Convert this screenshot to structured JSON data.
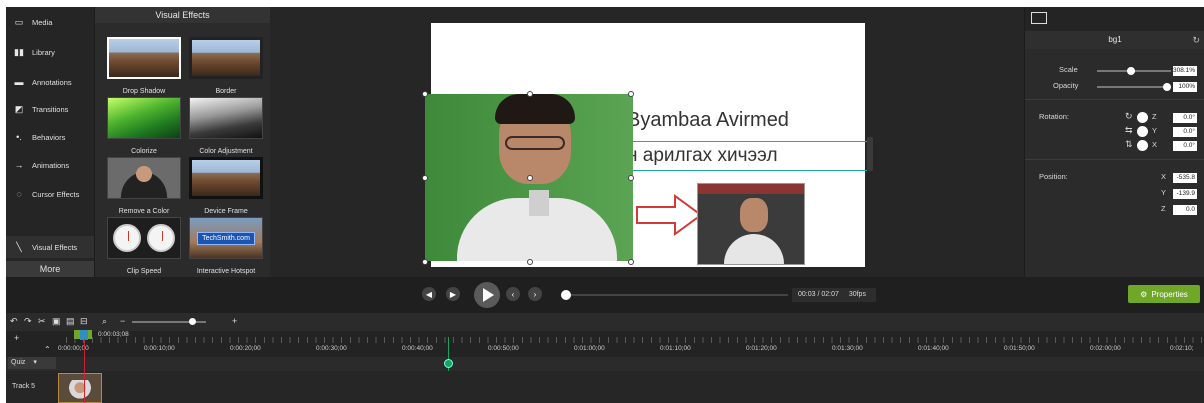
{
  "nav": {
    "items": [
      {
        "label": "Media",
        "icon": "media-icon"
      },
      {
        "label": "Library",
        "icon": "library-icon"
      },
      {
        "label": "Annotations",
        "icon": "annotations-icon"
      },
      {
        "label": "Transitions",
        "icon": "transitions-icon"
      },
      {
        "label": "Behaviors",
        "icon": "behaviors-icon"
      },
      {
        "label": "Animations",
        "icon": "animations-icon"
      },
      {
        "label": "Cursor Effects",
        "icon": "cursor-effects-icon"
      },
      {
        "label": "Visual Effects",
        "icon": "visual-effects-icon"
      }
    ],
    "more": "More"
  },
  "effects": {
    "title": "Visual Effects",
    "tiles": [
      "Drop Shadow",
      "Border",
      "Colorize",
      "Color Adjustment",
      "Remove a Color",
      "Device Frame",
      "Clip Speed",
      "Interactive Hotspot"
    ],
    "hotspot_badge": "TechSmith.com"
  },
  "preview": {
    "title": "Byambaa Avirmed",
    "subtitle": "н арилгах хичээл"
  },
  "properties": {
    "tab": "bg1",
    "scale_label": "Scale",
    "scale_value": "308.1%",
    "opacity_label": "Opacity",
    "opacity_value": "100%",
    "rotation_label": "Rotation:",
    "rotation": {
      "z_label": "Z",
      "z": "0.0°",
      "y_label": "Y",
      "y": "0.0°",
      "x_label": "X",
      "x": "0.0°"
    },
    "position_label": "Position:",
    "position": {
      "x_label": "X",
      "x": "-535.8",
      "y_label": "Y",
      "y": "-139.9",
      "z_label": "Z",
      "z": "0.0"
    },
    "button": "Properties",
    "colors": {
      "accent": "#6fa828"
    }
  },
  "playback": {
    "time": "00:03 / 02:07",
    "fps": "30fps"
  },
  "timeline": {
    "playhead_time": "0:00:03;08",
    "ticks": [
      "0:00:00;00",
      "0:00:10;00",
      "0:00:20;00",
      "0:00:30;00",
      "0:00:40;00",
      "0:00:50;00",
      "0:01:00;00",
      "0:01:10;00",
      "0:01:20;00",
      "0:01:30;00",
      "0:01:40;00",
      "0:01:50;00",
      "0:02:00;00",
      "0:02:10;"
    ],
    "quiz_label": "Quiz",
    "track_label": "Track 5"
  }
}
